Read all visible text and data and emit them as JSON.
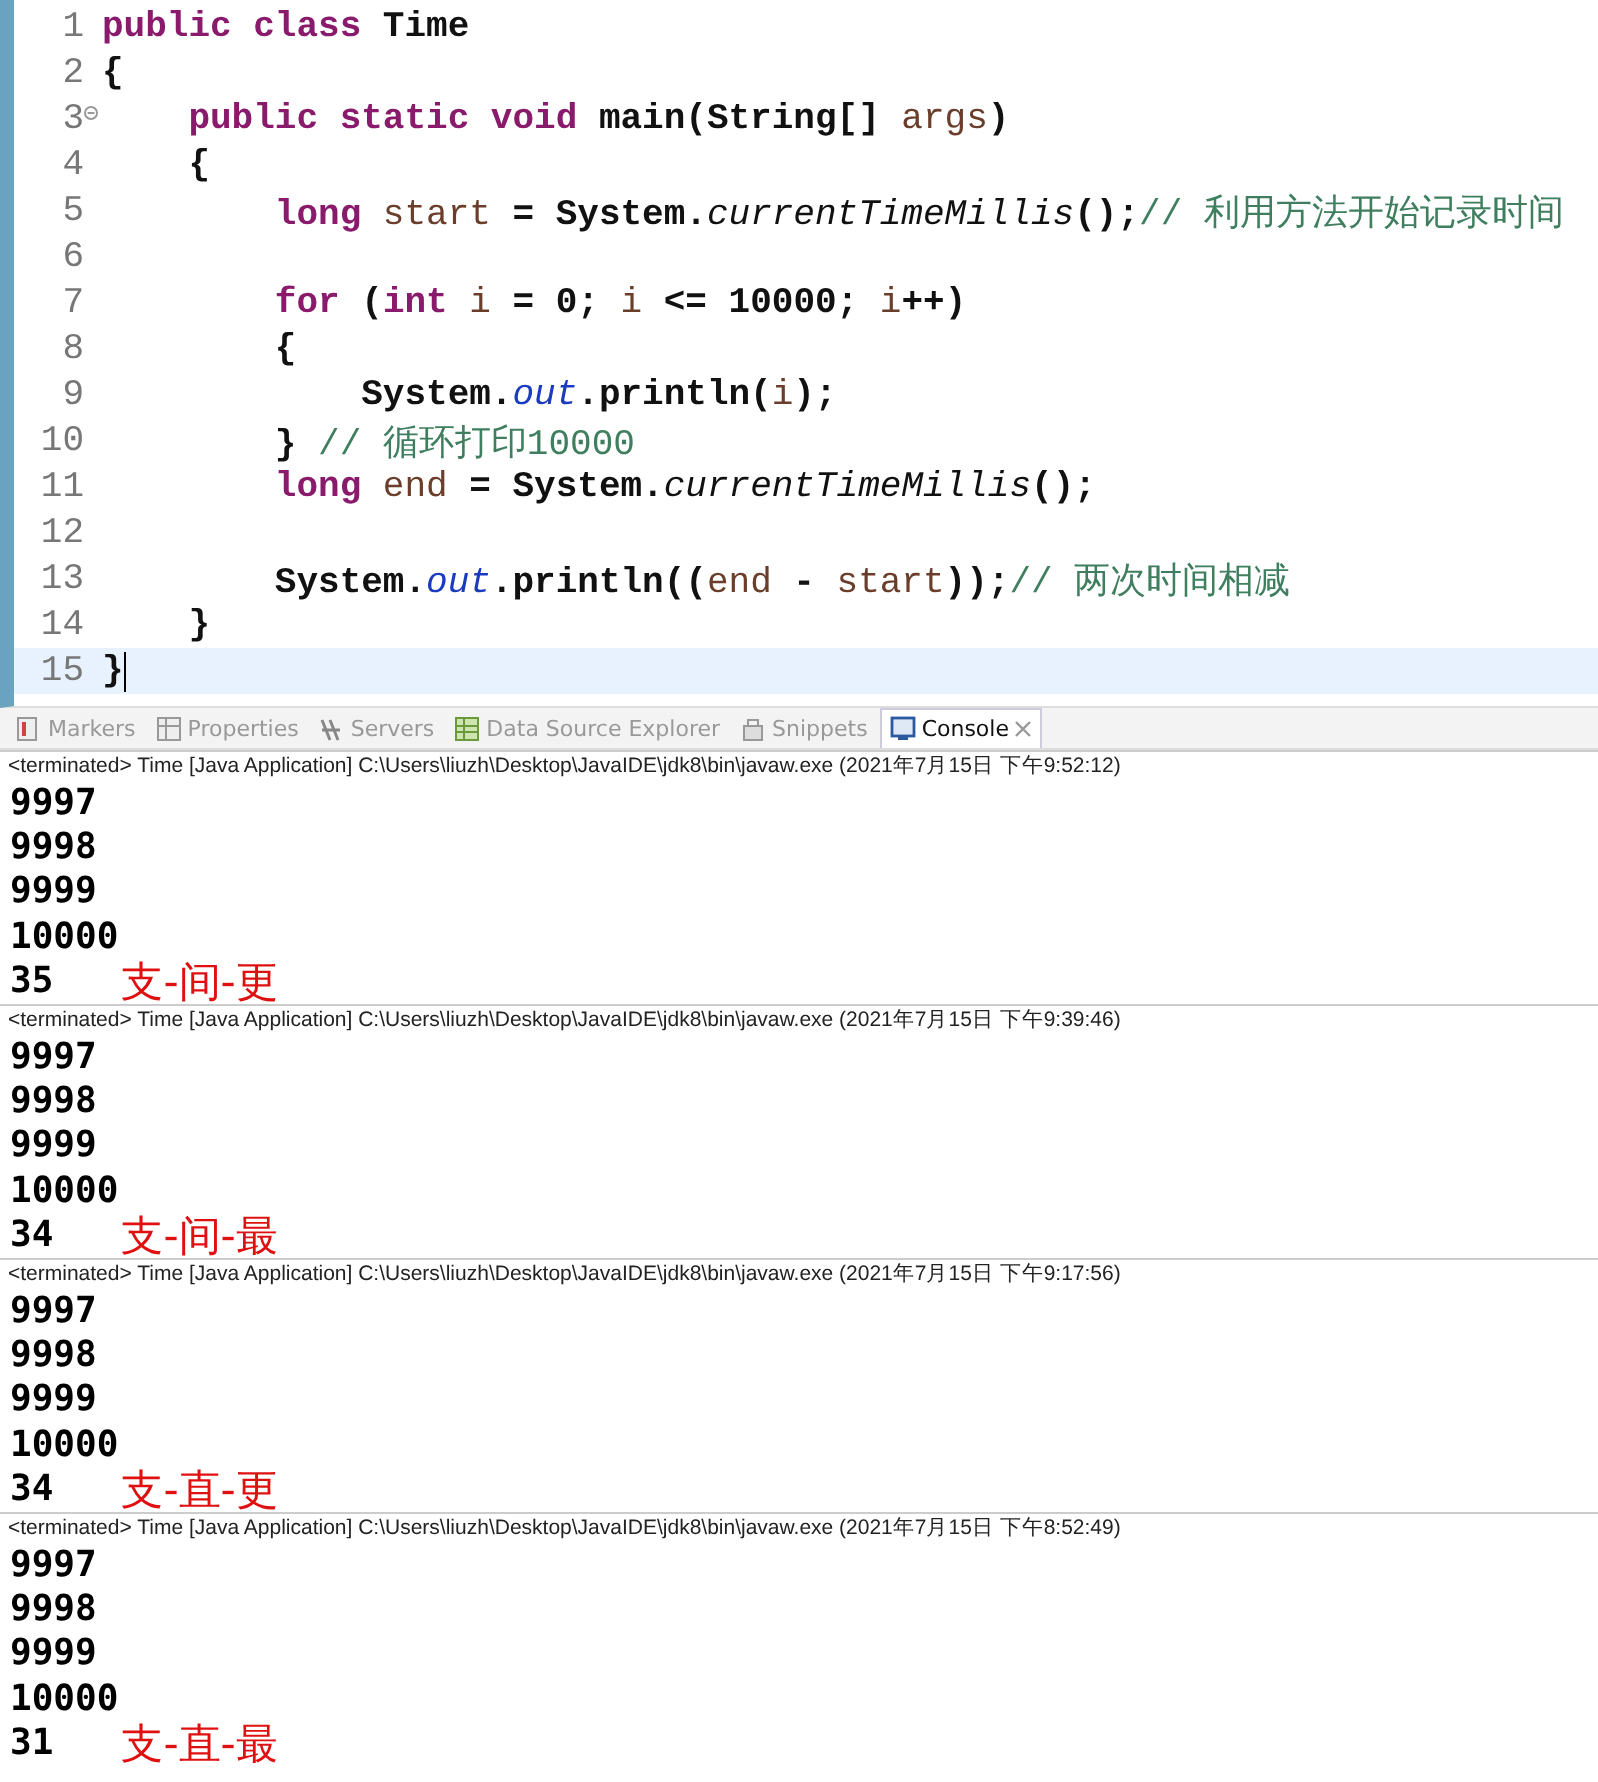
{
  "editor": {
    "lines": [
      {
        "number": "1",
        "current": false,
        "fold": false,
        "tokens": [
          {
            "kind": "keyword",
            "text": "public class"
          },
          {
            "kind": "plain",
            "text": " Time"
          }
        ]
      },
      {
        "number": "2",
        "current": false,
        "fold": false,
        "tokens": [
          {
            "kind": "plain",
            "text": "{"
          }
        ]
      },
      {
        "number": "3",
        "current": false,
        "fold": true,
        "tokens": [
          {
            "kind": "keyword",
            "text": "    public static void"
          },
          {
            "kind": "plain",
            "text": " main(String[] "
          },
          {
            "kind": "variable",
            "text": "args"
          },
          {
            "kind": "plain",
            "text": ")"
          }
        ]
      },
      {
        "number": "4",
        "current": false,
        "fold": false,
        "tokens": [
          {
            "kind": "plain",
            "text": "    {"
          }
        ]
      },
      {
        "number": "5",
        "current": false,
        "fold": false,
        "tokens": [
          {
            "kind": "keyword",
            "text": "        long"
          },
          {
            "kind": "variable",
            "text": " start"
          },
          {
            "kind": "plain",
            "text": " = System."
          },
          {
            "kind": "static",
            "text": "currentTimeMillis"
          },
          {
            "kind": "plain",
            "text": "();"
          },
          {
            "kind": "comment",
            "text": "// 利用方法开始记录时间"
          }
        ]
      },
      {
        "number": "6",
        "current": false,
        "fold": false
      },
      {
        "number": "7",
        "current": false,
        "fold": false,
        "tokens": [
          {
            "kind": "keyword",
            "text": "        for"
          },
          {
            "kind": "plain",
            "text": " ("
          },
          {
            "kind": "keyword",
            "text": "int"
          },
          {
            "kind": "variable",
            "text": " i"
          },
          {
            "kind": "plain",
            "text": " = 0; "
          },
          {
            "kind": "variable",
            "text": "i"
          },
          {
            "kind": "plain",
            "text": " <= 10000; "
          },
          {
            "kind": "variable",
            "text": "i"
          },
          {
            "kind": "plain",
            "text": "++)"
          }
        ]
      },
      {
        "number": "8",
        "current": false,
        "fold": false,
        "tokens": [
          {
            "kind": "plain",
            "text": "        {"
          }
        ]
      },
      {
        "number": "9",
        "current": false,
        "fold": false,
        "tokens": [
          {
            "kind": "plain",
            "text": "            System."
          },
          {
            "kind": "field",
            "text": "out"
          },
          {
            "kind": "plain",
            "text": ".println("
          },
          {
            "kind": "variable",
            "text": "i"
          },
          {
            "kind": "plain",
            "text": ");"
          }
        ]
      },
      {
        "number": "10",
        "current": false,
        "fold": false,
        "tokens": [
          {
            "kind": "plain",
            "text": "        } "
          },
          {
            "kind": "comment",
            "text": "// 循环打印10000"
          }
        ]
      },
      {
        "number": "11",
        "current": false,
        "fold": false,
        "tokens": [
          {
            "kind": "keyword",
            "text": "        long"
          },
          {
            "kind": "variable",
            "text": " end"
          },
          {
            "kind": "plain",
            "text": " = System."
          },
          {
            "kind": "static",
            "text": "currentTimeMillis"
          },
          {
            "kind": "plain",
            "text": "();"
          }
        ]
      },
      {
        "number": "12",
        "current": false,
        "fold": false
      },
      {
        "number": "13",
        "current": false,
        "fold": false,
        "tokens": [
          {
            "kind": "plain",
            "text": "        System."
          },
          {
            "kind": "field",
            "text": "out"
          },
          {
            "kind": "plain",
            "text": ".println(("
          },
          {
            "kind": "variable",
            "text": "end"
          },
          {
            "kind": "plain",
            "text": " - "
          },
          {
            "kind": "variable",
            "text": "start"
          },
          {
            "kind": "plain",
            "text": "));"
          },
          {
            "kind": "comment",
            "text": "// 两次时间相减"
          }
        ]
      },
      {
        "number": "14",
        "current": false,
        "fold": false,
        "tokens": [
          {
            "kind": "plain",
            "text": "    }"
          }
        ]
      },
      {
        "number": "15",
        "current": true,
        "fold": false,
        "tokens": [
          {
            "kind": "plain",
            "text": "}"
          }
        ]
      }
    ]
  },
  "tabs": [
    {
      "label": "Markers",
      "selected": false
    },
    {
      "label": "Properties",
      "selected": false
    },
    {
      "label": "Servers",
      "selected": false
    },
    {
      "label": "Data Source Explorer",
      "selected": false
    },
    {
      "label": "Snippets",
      "selected": false
    },
    {
      "label": "Console",
      "selected": true
    }
  ],
  "console_runs": [
    {
      "header": "<terminated> Time [Java Application] C:\\Users\\liuzh\\Desktop\\JavaIDE\\jdk8\\bin\\javaw.exe (2021年7月15日 下午9:52:12)",
      "lines": [
        "9997",
        "9998",
        "9999",
        "10000",
        "35"
      ],
      "annotation": "支-间-更"
    },
    {
      "header": "<terminated> Time [Java Application] C:\\Users\\liuzh\\Desktop\\JavaIDE\\jdk8\\bin\\javaw.exe (2021年7月15日 下午9:39:46)",
      "lines": [
        "9997",
        "9998",
        "9999",
        "10000",
        "34"
      ],
      "annotation": "支-间-最"
    },
    {
      "header": "<terminated> Time [Java Application] C:\\Users\\liuzh\\Desktop\\JavaIDE\\jdk8\\bin\\javaw.exe (2021年7月15日 下午9:17:56)",
      "lines": [
        "9997",
        "9998",
        "9999",
        "10000",
        "34"
      ],
      "annotation": "支-直-更"
    },
    {
      "header": "<terminated> Time [Java Application] C:\\Users\\liuzh\\Desktop\\JavaIDE\\jdk8\\bin\\javaw.exe (2021年7月15日 下午8:52:49)",
      "lines": [
        "9997",
        "9998",
        "9999",
        "10000",
        "31"
      ],
      "annotation": "支-直-最"
    }
  ]
}
